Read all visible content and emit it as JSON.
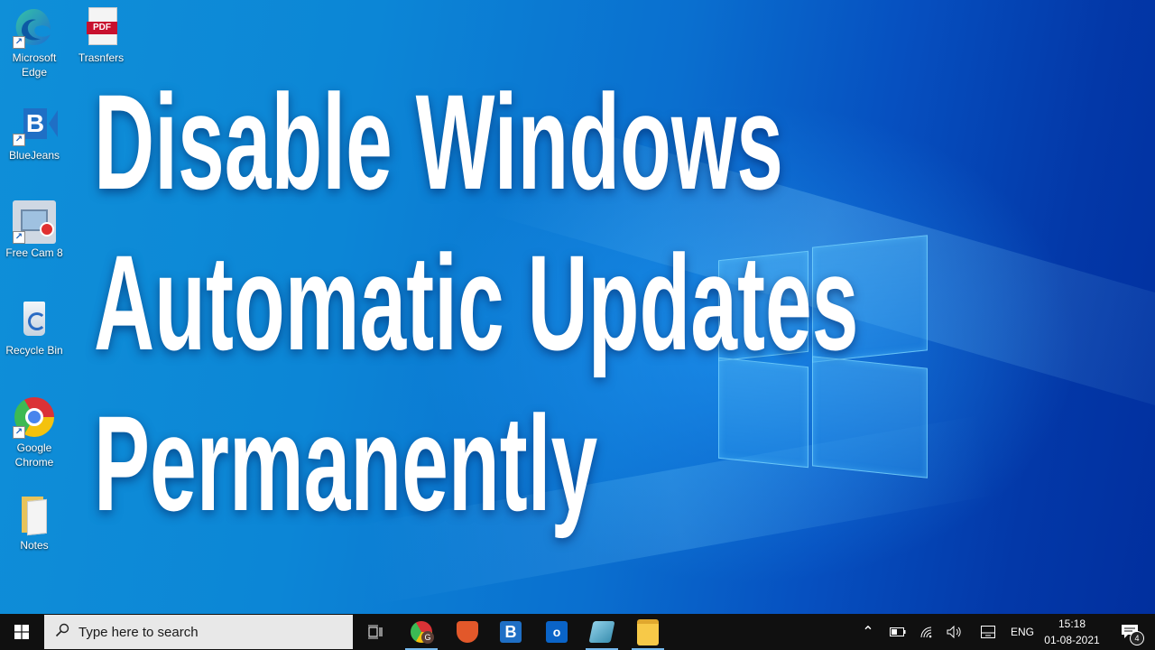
{
  "desktop": {
    "icons": [
      {
        "label_line1": "Microsoft",
        "label_line2": "Edge",
        "icon": "edge-icon",
        "shortcut": true
      },
      {
        "label_line1": "Trasnfers",
        "label_line2": "",
        "icon": "pdf-file-icon",
        "badge": "PDF",
        "shortcut": false
      },
      {
        "label_line1": "BlueJeans",
        "label_line2": "",
        "icon": "bluejeans-icon",
        "badge": "B",
        "shortcut": true
      },
      {
        "label_line1": "Free Cam 8",
        "label_line2": "",
        "icon": "free-cam-icon",
        "shortcut": true
      },
      {
        "label_line1": "Recycle Bin",
        "label_line2": "",
        "icon": "recycle-bin-icon",
        "shortcut": false
      },
      {
        "label_line1": "Google",
        "label_line2": "Chrome",
        "icon": "chrome-icon",
        "shortcut": true
      },
      {
        "label_line1": "Notes",
        "label_line2": "",
        "icon": "folder-icon",
        "shortcut": false
      }
    ],
    "shortcut_glyph": "↗"
  },
  "overlay_title": {
    "line1": "Disable Windows",
    "line2": "Automatic Updates",
    "line3": "Permanently"
  },
  "taskbar": {
    "start_icon": "windows-logo-icon",
    "search_placeholder": "Type here to search",
    "search_icon_glyph": "⚲",
    "pinned_apps": [
      {
        "name": "task-view",
        "icon": "task-view-icon",
        "glyph": "⧉"
      },
      {
        "name": "chrome",
        "icon": "chrome-profile-icon",
        "badge": "G",
        "active": true
      },
      {
        "name": "security-app",
        "icon": "shield-app-icon"
      },
      {
        "name": "bluejeans",
        "icon": "bluejeans-icon",
        "badge": "B"
      },
      {
        "name": "outlook",
        "icon": "outlook-icon",
        "badge": "o"
      },
      {
        "name": "notes-app",
        "icon": "notepad-icon",
        "active": true
      },
      {
        "name": "file-explorer",
        "icon": "file-explorer-icon",
        "active": true
      }
    ],
    "tray": {
      "chevron_glyph": "⌃",
      "language": "ENG",
      "time": "15:18",
      "date": "01-08-2021",
      "notification_count": "4"
    }
  },
  "colors": {
    "taskbar_bg": "#101010",
    "search_bg": "#e8e8e8",
    "accent": "#76b9ed",
    "pdf_red": "#c8102e",
    "bluejeans_blue": "#1f6fc5"
  }
}
